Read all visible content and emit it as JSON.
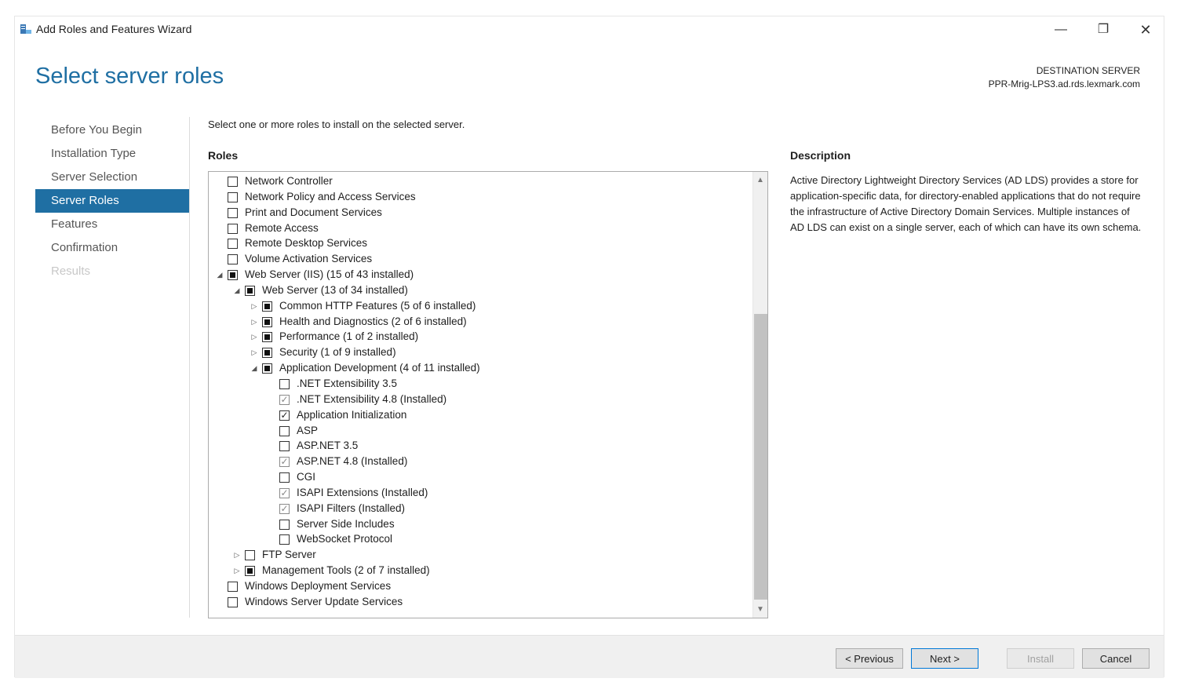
{
  "window": {
    "title": "Add Roles and Features Wizard",
    "minimize_glyph": "—",
    "maximize_glyph": "❐",
    "close_glyph": "✕"
  },
  "header": {
    "page_title": "Select server roles",
    "destination_label": "DESTINATION SERVER",
    "destination_server": "PPR-Mrig-LPS3.ad.rds.lexmark.com"
  },
  "nav": {
    "items": [
      {
        "label": "Before You Begin",
        "state": "normal"
      },
      {
        "label": "Installation Type",
        "state": "normal"
      },
      {
        "label": "Server Selection",
        "state": "normal"
      },
      {
        "label": "Server Roles",
        "state": "active"
      },
      {
        "label": "Features",
        "state": "normal"
      },
      {
        "label": "Confirmation",
        "state": "normal"
      },
      {
        "label": "Results",
        "state": "disabled"
      }
    ]
  },
  "main": {
    "instruction": "Select one or more roles to install on the selected server.",
    "roles_header": "Roles",
    "description_header": "Description",
    "description_text": "Active Directory Lightweight Directory Services (AD LDS) provides a store for application-specific data, for directory-enabled applications that do not require the infrastructure of Active Directory Domain Services. Multiple instances of AD LDS can exist on a single server, each of which can have its own schema."
  },
  "roles": [
    {
      "label": "Network Controller",
      "level": 0,
      "expander": "",
      "check": "none"
    },
    {
      "label": "Network Policy and Access Services",
      "level": 0,
      "expander": "",
      "check": "none"
    },
    {
      "label": "Print and Document Services",
      "level": 0,
      "expander": "",
      "check": "none"
    },
    {
      "label": "Remote Access",
      "level": 0,
      "expander": "",
      "check": "none"
    },
    {
      "label": "Remote Desktop Services",
      "level": 0,
      "expander": "",
      "check": "none"
    },
    {
      "label": "Volume Activation Services",
      "level": 0,
      "expander": "",
      "check": "none"
    },
    {
      "label": "Web Server (IIS) (15 of 43 installed)",
      "level": 0,
      "expander": "expanded",
      "check": "partial"
    },
    {
      "label": "Web Server (13 of 34 installed)",
      "level": 1,
      "expander": "expanded",
      "check": "partial"
    },
    {
      "label": "Common HTTP Features (5 of 6 installed)",
      "level": 2,
      "expander": "collapsed",
      "check": "partial"
    },
    {
      "label": "Health and Diagnostics (2 of 6 installed)",
      "level": 2,
      "expander": "collapsed",
      "check": "partial"
    },
    {
      "label": "Performance (1 of 2 installed)",
      "level": 2,
      "expander": "collapsed",
      "check": "partial"
    },
    {
      "label": "Security (1 of 9 installed)",
      "level": 2,
      "expander": "collapsed",
      "check": "partial"
    },
    {
      "label": "Application Development (4 of 11 installed)",
      "level": 2,
      "expander": "expanded",
      "check": "partial"
    },
    {
      "label": ".NET Extensibility 3.5",
      "level": 3,
      "expander": "",
      "check": "none"
    },
    {
      "label": ".NET Extensibility 4.8 (Installed)",
      "level": 3,
      "expander": "",
      "check": "installed"
    },
    {
      "label": "Application Initialization",
      "level": 3,
      "expander": "",
      "check": "checked"
    },
    {
      "label": "ASP",
      "level": 3,
      "expander": "",
      "check": "none"
    },
    {
      "label": "ASP.NET 3.5",
      "level": 3,
      "expander": "",
      "check": "none"
    },
    {
      "label": "ASP.NET 4.8 (Installed)",
      "level": 3,
      "expander": "",
      "check": "installed"
    },
    {
      "label": "CGI",
      "level": 3,
      "expander": "",
      "check": "none"
    },
    {
      "label": "ISAPI Extensions (Installed)",
      "level": 3,
      "expander": "",
      "check": "installed"
    },
    {
      "label": "ISAPI Filters (Installed)",
      "level": 3,
      "expander": "",
      "check": "installed"
    },
    {
      "label": "Server Side Includes",
      "level": 3,
      "expander": "",
      "check": "none"
    },
    {
      "label": "WebSocket Protocol",
      "level": 3,
      "expander": "",
      "check": "none"
    },
    {
      "label": "FTP Server",
      "level": 1,
      "expander": "collapsed",
      "check": "none"
    },
    {
      "label": "Management Tools (2 of 7 installed)",
      "level": 1,
      "expander": "collapsed",
      "check": "partial"
    },
    {
      "label": "Windows Deployment Services",
      "level": 0,
      "expander": "",
      "check": "none"
    },
    {
      "label": "Windows Server Update Services",
      "level": 0,
      "expander": "",
      "check": "none"
    }
  ],
  "footer": {
    "previous": "< Previous",
    "next": "Next >",
    "install": "Install",
    "cancel": "Cancel"
  },
  "colors": {
    "accent": "#1f6fa3",
    "footer_bg": "#f0f0f0",
    "scroll_thumb": "#c2c2c2"
  }
}
